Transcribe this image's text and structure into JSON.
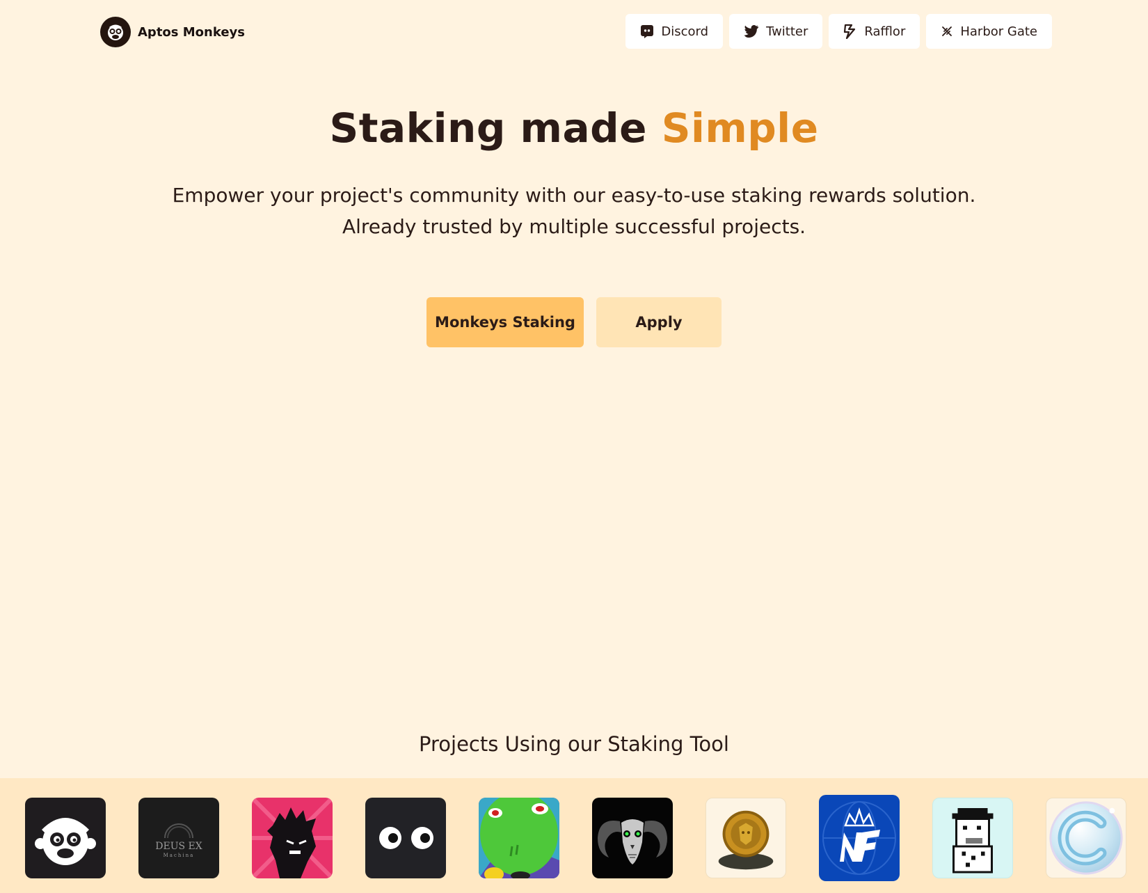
{
  "brand": {
    "name": "Aptos Monkeys",
    "logo_icon": "monkey-logo-icon"
  },
  "nav": {
    "links": [
      {
        "label": "Discord",
        "icon": "discord-icon"
      },
      {
        "label": "Twitter",
        "icon": "twitter-icon"
      },
      {
        "label": "Rafflor",
        "icon": "rafflor-icon"
      },
      {
        "label": "Harbor Gate",
        "icon": "harbor-gate-icon"
      }
    ]
  },
  "hero": {
    "title_main": "Staking made",
    "title_accent": "Simple",
    "subtitle_line1": "Empower your project's community with our easy-to-use staking rewards solution.",
    "subtitle_line2": "Already trusted by multiple successful projects.",
    "primary_button": "Monkeys Staking",
    "secondary_button": "Apply"
  },
  "projects": {
    "title": "Projects Using our Staking Tool",
    "logos": [
      {
        "icon": "aptos-monkeys-logo"
      },
      {
        "icon": "deus-ex-machina-logo",
        "text": "DEUS EX",
        "subtext": "Machina"
      },
      {
        "icon": "angry-silhouette-logo"
      },
      {
        "icon": "googly-eyes-logo"
      },
      {
        "icon": "green-monster-logo"
      },
      {
        "icon": "ram-skull-logo"
      },
      {
        "icon": "gold-coin-logo"
      },
      {
        "icon": "nf-crown-logo",
        "text": "NF"
      },
      {
        "icon": "pixel-character-logo"
      },
      {
        "icon": "chrome-c-logo",
        "text": "C"
      }
    ]
  },
  "colors": {
    "background": "#fff3e0",
    "accent": "#e08a22",
    "primary_button": "#ffc266",
    "secondary_button": "#ffe4b5",
    "text": "#2b1b17",
    "strip": "#ffe8c4"
  }
}
